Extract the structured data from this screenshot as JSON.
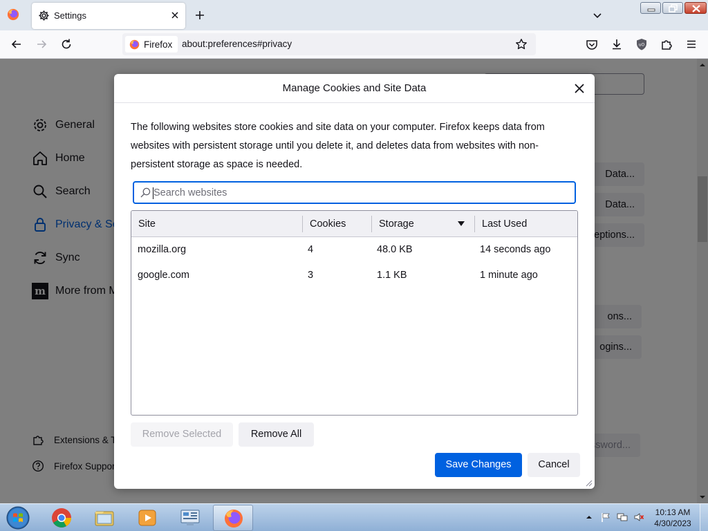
{
  "browser": {
    "tab": {
      "title": "Settings"
    },
    "identity_label": "Firefox",
    "url": "about:preferences#privacy"
  },
  "sidebar": {
    "categories": [
      {
        "label": "General",
        "icon": "gear-icon"
      },
      {
        "label": "Home",
        "icon": "home-icon"
      },
      {
        "label": "Search",
        "icon": "search-icon"
      },
      {
        "label": "Privacy & Se",
        "icon": "lock-icon"
      },
      {
        "label": "Sync",
        "icon": "sync-icon"
      },
      {
        "label": "More from M",
        "icon": "mozilla-icon"
      }
    ],
    "footer": [
      {
        "label": "Extensions & T",
        "icon": "puzzle-icon"
      },
      {
        "label": "Firefox Suppor",
        "icon": "help-icon"
      }
    ]
  },
  "background_buttons": [
    "Data...",
    "Data...",
    "eptions...",
    "ons...",
    "ogins...",
    "ssword..."
  ],
  "dialog": {
    "title": "Manage Cookies and Site Data",
    "description": "The following websites store cookies and site data on your computer. Firefox keeps data from websites with persistent storage until you delete it, and deletes data from websites with non-persistent storage as space is needed.",
    "search_placeholder": "Search websites",
    "columns": [
      "Site",
      "Cookies",
      "Storage",
      "Last Used"
    ],
    "rows": [
      {
        "site": "mozilla.org",
        "cookies": "4",
        "storage": "48.0 KB",
        "last_used": "14 seconds ago"
      },
      {
        "site": "google.com",
        "cookies": "3",
        "storage": "1.1 KB",
        "last_used": "1 minute ago"
      }
    ],
    "remove_selected": "Remove Selected",
    "remove_all": "Remove All",
    "save_changes": "Save Changes",
    "cancel": "Cancel"
  },
  "taskbar": {
    "apps": [
      "chrome-icon",
      "file-explorer-icon",
      "media-player-icon",
      "control-panel-icon",
      "firefox-icon"
    ],
    "active_app": "firefox-icon",
    "time": "10:13 AM",
    "date": "4/30/2023"
  },
  "colors": {
    "accent": "#0061e0",
    "overlay": "rgba(0,0,0,0.5)"
  }
}
